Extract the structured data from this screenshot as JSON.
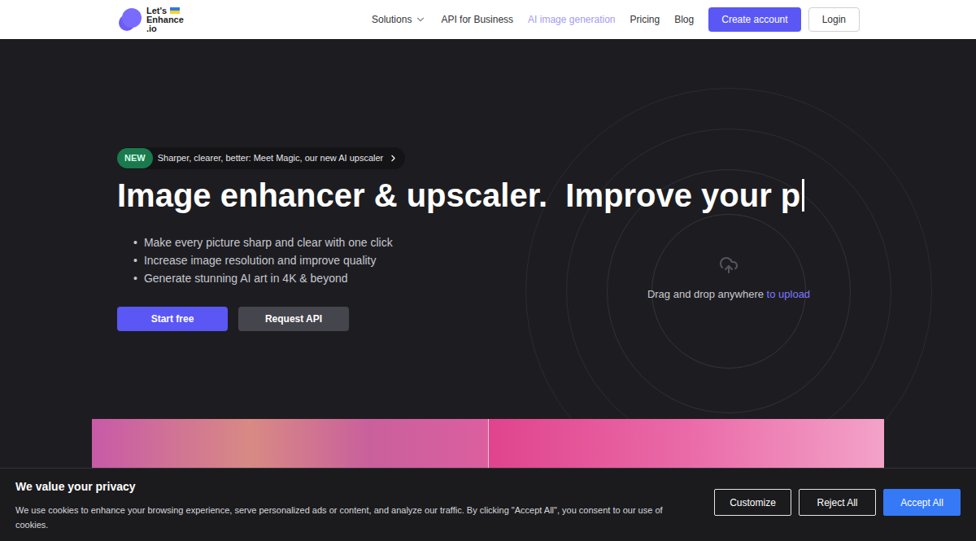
{
  "logo": {
    "lines": [
      "Let's",
      "Enhance",
      ".io"
    ]
  },
  "nav": {
    "items": [
      {
        "label": "Solutions",
        "dropdown": true,
        "highlighted": false
      },
      {
        "label": "API for Business",
        "dropdown": false,
        "highlighted": false
      },
      {
        "label": "AI image generation",
        "dropdown": false,
        "highlighted": true
      },
      {
        "label": "Pricing",
        "dropdown": false,
        "highlighted": false
      },
      {
        "label": "Blog",
        "dropdown": false,
        "highlighted": false
      }
    ],
    "buttons": [
      {
        "label": "Create account",
        "kind": "primary"
      },
      {
        "label": "Login",
        "kind": "outline"
      }
    ]
  },
  "hero": {
    "badge": "NEW",
    "announcement": "Sharper, clearer, better: Meet Magic, our new AI upscaler",
    "heading": "Image enhancer & upscaler.  Improve your p",
    "typing_cursor": true,
    "bullet": "•",
    "bullets": [
      "Make every picture sharp and clear with one click",
      "Increase image resolution and improve quality",
      "Generate stunning AI art in 4K & beyond"
    ],
    "buttons": [
      {
        "label": "Start free",
        "kind": "primary"
      },
      {
        "label": "Request API",
        "kind": "secondary"
      }
    ],
    "upload": {
      "text": "Drag and drop anywhere",
      "link": "to upload"
    }
  },
  "cookie": {
    "title": "We value your privacy",
    "text": "We use cookies to enhance your browsing experience, serve personalized ads or content, and analyze our traffic. By clicking \"Accept All\", you consent to our use of cookies.",
    "buttons": [
      {
        "label": "Customize",
        "kind": "outline"
      },
      {
        "label": "Reject All",
        "kind": "outline"
      },
      {
        "label": "Accept All",
        "kind": "primary"
      }
    ]
  }
}
